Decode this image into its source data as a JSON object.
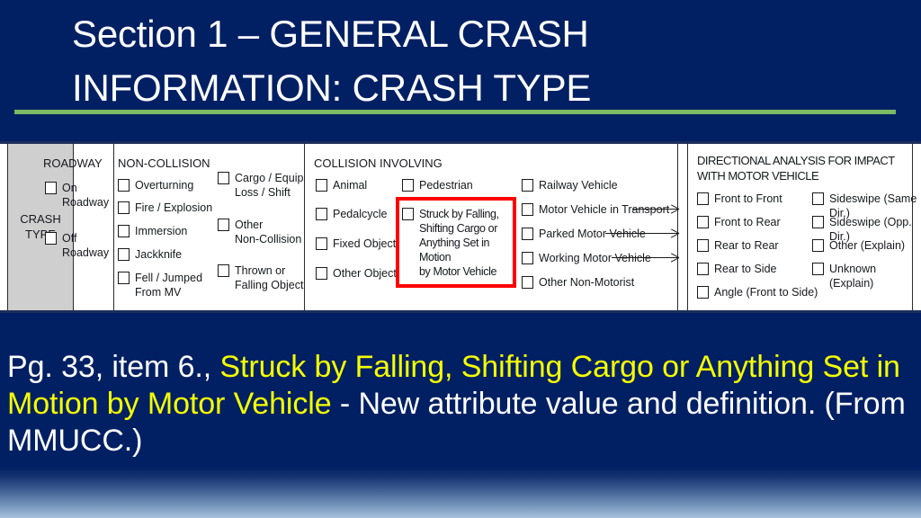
{
  "slide": {
    "title_line1": "Section 1 – GENERAL CRASH",
    "title_line2": "INFORMATION: CRASH TYPE",
    "accent_rule_color": "#7cb963",
    "background_color": "#002063"
  },
  "form": {
    "row_label": "CRASH\nTYPE",
    "groups": {
      "roadway": {
        "title": "ROADWAY",
        "items": [
          "On\nRoadway",
          "Off\nRoadway"
        ]
      },
      "non_collision": {
        "title": "NON-COLLISION",
        "column1": [
          "Overturning",
          "Fire / Explosion",
          "Immersion",
          "Jackknife",
          "Fell / Jumped\nFrom MV"
        ],
        "column2": [
          "Cargo / Equip\nLoss / Shift",
          "Other\nNon-Collision",
          "Thrown or\nFalling Object"
        ]
      },
      "collision_involving": {
        "title": "COLLISION INVOLVING",
        "column1": [
          "Animal",
          "Pedalcycle",
          "Fixed Object",
          "Other Object"
        ],
        "column2": [
          "Pedestrian",
          "Struck by Falling,\nShifting Cargo or\nAnything Set in Motion\nby Motor Vehicle"
        ],
        "column3": [
          "Railway Vehicle",
          "Motor Vehicle in Transport",
          "Parked Motor Vehicle",
          "Working Motor Vehicle",
          "Other Non-Motorist"
        ],
        "highlight_color": "#ff0000",
        "highlighted_item": "Struck by Falling, Shifting Cargo or Anything Set in Motion by Motor Vehicle"
      },
      "directional": {
        "title_line1": "DIRECTIONAL ANALYSIS FOR IMPACT",
        "title_line2": "WITH MOTOR VEHICLE",
        "column1": [
          "Front to Front",
          "Front to Rear",
          "Rear to Rear",
          "Rear to Side",
          "Angle (Front to Side)"
        ],
        "column2": [
          "Sideswipe (Same Dir.)",
          "Sideswipe (Opp. Dir.)",
          "Other (Explain)",
          "Unknown (Explain)"
        ]
      }
    }
  },
  "caption": {
    "part1": "Pg. 33, item 6., ",
    "highlight": "Struck by Falling, Shifting Cargo or Anything Set in Motion by Motor Vehicle",
    "part2": " - New attribute value and definition. (From MMUCC.)",
    "highlight_color": "#f6ff00"
  }
}
